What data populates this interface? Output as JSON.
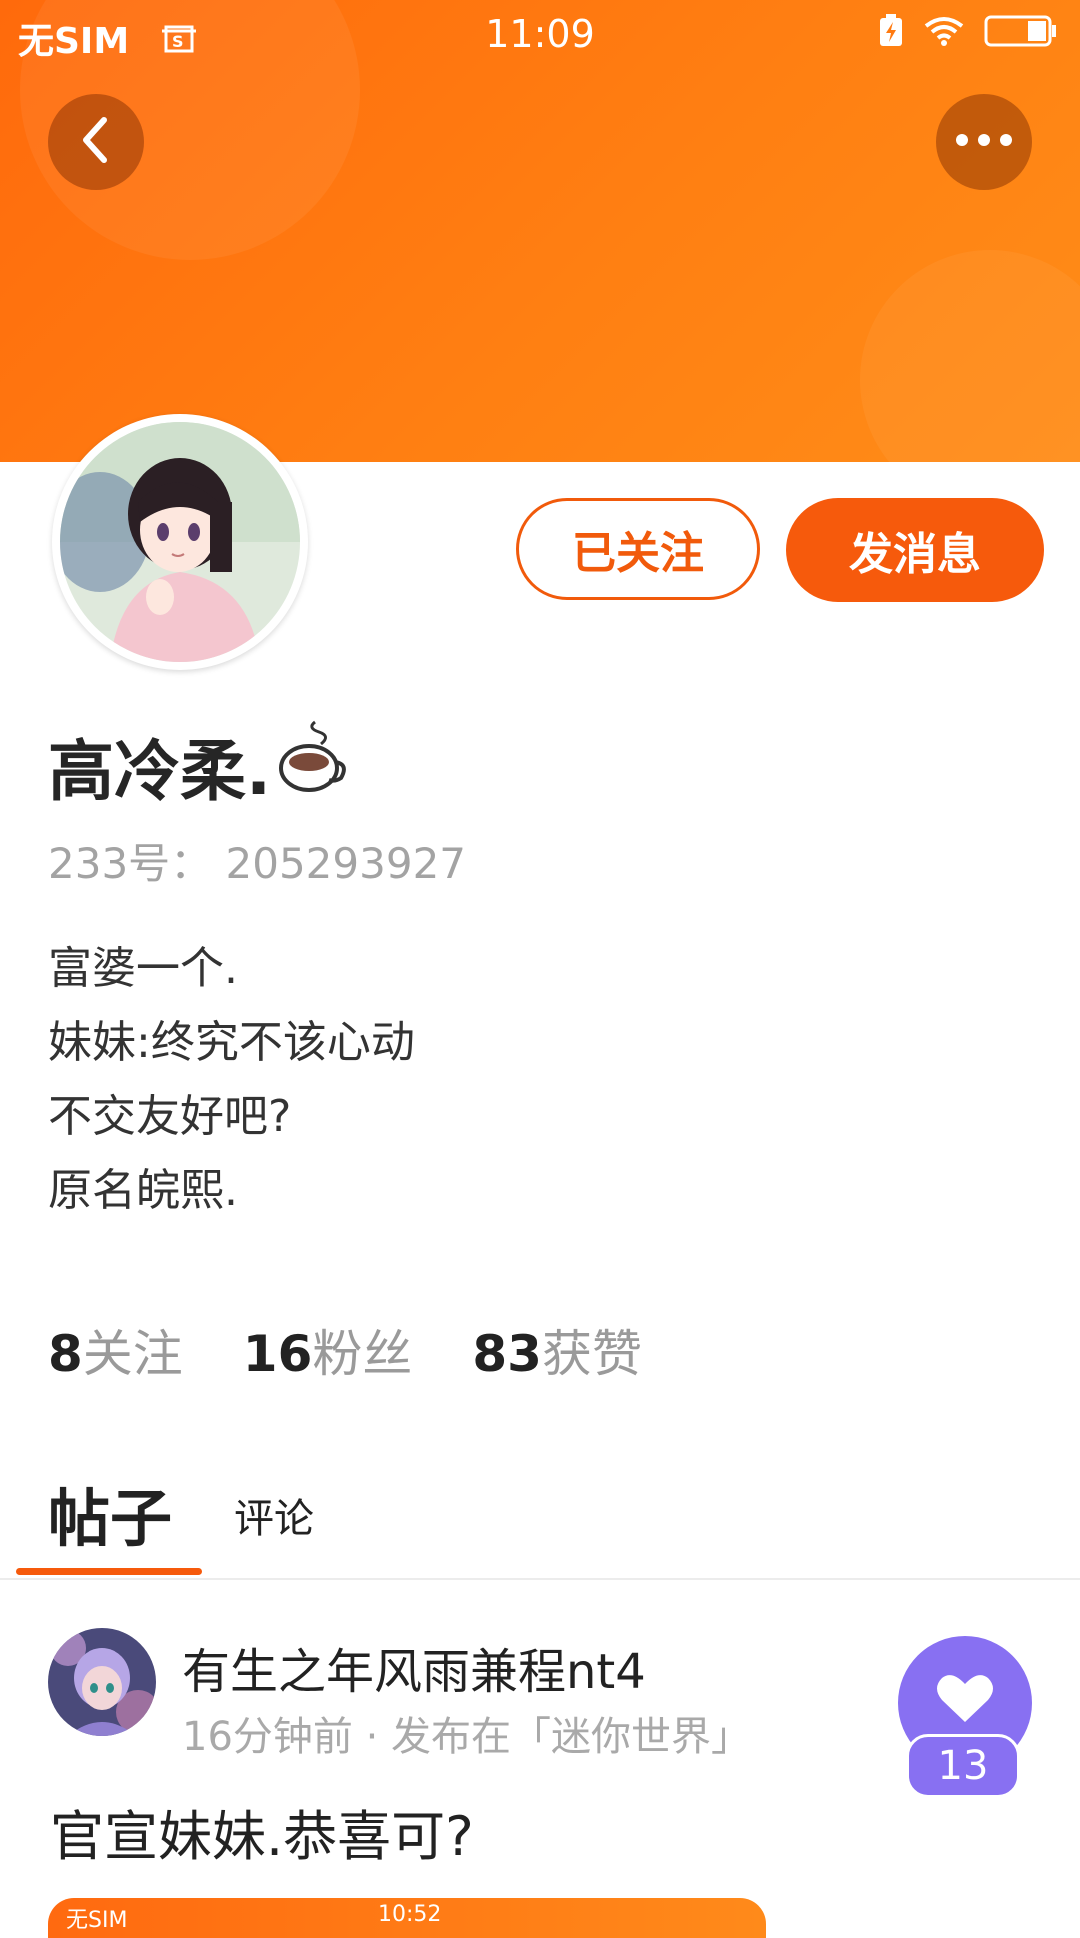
{
  "status_bar": {
    "carrier": "无SIM",
    "time": "11:09"
  },
  "header": {
    "back_icon": "chevron-left-icon",
    "more_icon": "more-dots-icon",
    "gradient_start": "#ff6a0c",
    "gradient_end": "#ff8d18"
  },
  "profile": {
    "name": "高冷柔.",
    "name_emoji": "coffee-cup-icon",
    "uid": "233号： 205293927",
    "bio": [
      "富婆一个.",
      "妹妹:终究不该心动",
      "不交友好吧?",
      "原名皖熙."
    ],
    "follow_button": "已关注",
    "message_button": "发消息",
    "accent_color": "#f65a0c"
  },
  "stats": [
    {
      "num": "8",
      "label": "关注"
    },
    {
      "num": "16",
      "label": "粉丝"
    },
    {
      "num": "83",
      "label": "获赞"
    }
  ],
  "tabs": {
    "posts": "帖子",
    "comments": "评论"
  },
  "post": {
    "author": "有生之年风雨兼程nt4",
    "meta": "16分钟前 · 发布在「迷你世界」",
    "title": "官宣妹妹.恭喜可?",
    "like_count": "13",
    "like_color": "#8870f2",
    "image_status_carrier": "无SIM",
    "image_status_time": "10:52"
  }
}
